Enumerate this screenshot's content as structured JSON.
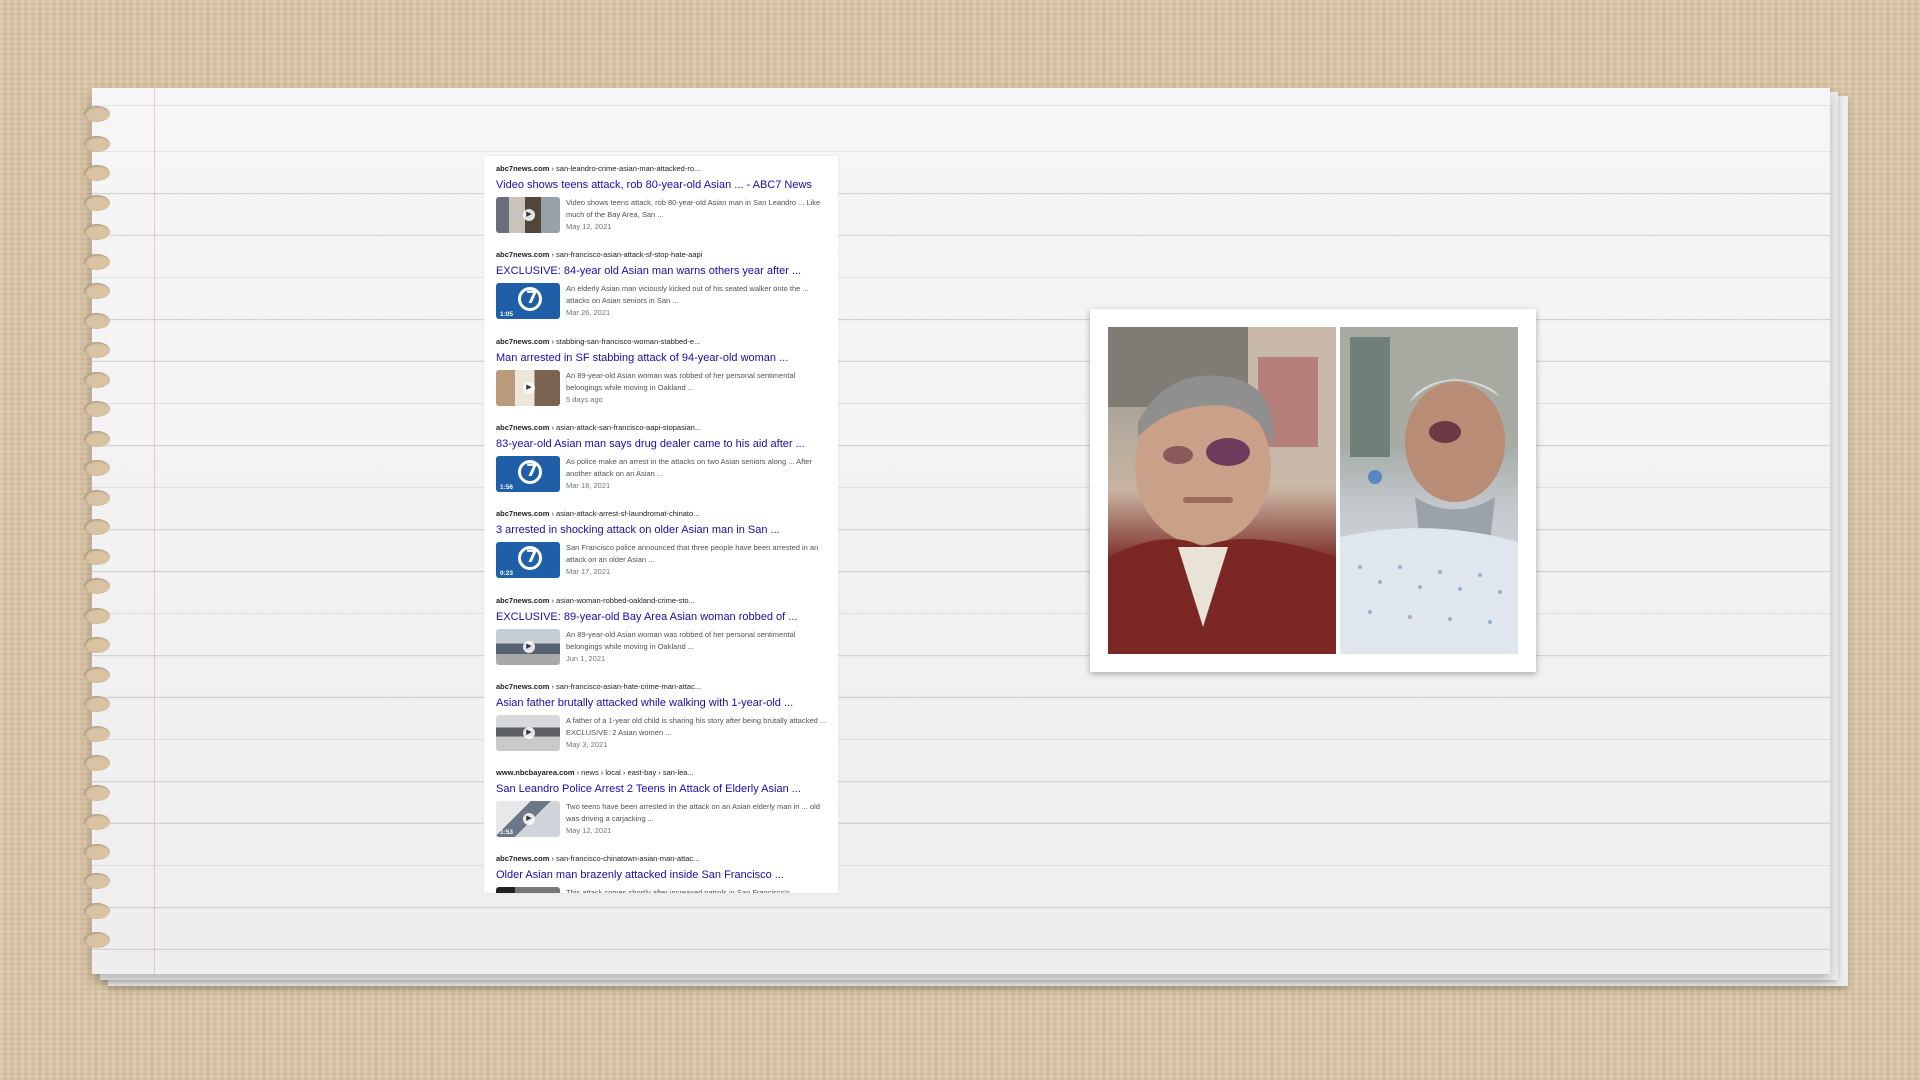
{
  "results": [
    {
      "cite_domain": "abc7news.com",
      "cite_path": " › san-leandro-crime-asian-man-attacked-ro...",
      "title": "Video shows teens attack, rob 80-year-old Asian ... - ABC7 News",
      "thumb": "photo1",
      "duration": "",
      "snippet": "Video shows teens attack, rob 80-year-old Asian man in San Leandro ... Like much of the Bay Area, San ...",
      "date": "May 12, 2021"
    },
    {
      "cite_domain": "abc7news.com",
      "cite_path": " › san-francisco-asian-attack-sf-stop-hate-aapi",
      "title": "EXCLUSIVE: 84-year old Asian man warns others year after ...",
      "thumb": "abc",
      "duration": "1:05",
      "snippet": "An elderly Asian man viciously kicked out of his seated walker onto the ... attacks on Asian seniors in San ...",
      "date": "Mar 26, 2021"
    },
    {
      "cite_domain": "abc7news.com",
      "cite_path": " › stabbing-san-francisco-woman-stabbed-e...",
      "title": "Man arrested in SF stabbing attack of 94-year-old woman ...",
      "thumb": "photo2",
      "duration": "",
      "snippet": "An 89-year-old Asian woman was robbed of her personal sentimental belongings while moving in Oakland ...",
      "date": "5 days ago"
    },
    {
      "cite_domain": "abc7news.com",
      "cite_path": " › asian-attack-san-francisco-aapi-stopasian...",
      "title": "83-year-old Asian man says drug dealer came to his aid after ...",
      "thumb": "abc",
      "duration": "1:56",
      "snippet": "As police make an arrest in the attacks on two Asian seniors along ... After another attack on an Asian ...",
      "date": "Mar 18, 2021"
    },
    {
      "cite_domain": "abc7news.com",
      "cite_path": " › asian-attack-arrest-sf-laundromat-chinato...",
      "title": "3 arrested in shocking attack on older Asian man in San ...",
      "thumb": "abc",
      "duration": "0:23",
      "snippet": "San Francisco police announced that three people have been arrested in an attack on an older Asian ...",
      "date": "Mar 17, 2021"
    },
    {
      "cite_domain": "abc7news.com",
      "cite_path": " › asian-woman-robbed-oakland-crime-sto...",
      "title": "EXCLUSIVE: 89-year-old Bay Area Asian woman robbed of ...",
      "thumb": "photo3",
      "duration": "",
      "snippet": "An 89-year-old Asian woman was robbed of her personal sentimental belongings while moving in Oakland ...",
      "date": "Jun 1, 2021"
    },
    {
      "cite_domain": "abc7news.com",
      "cite_path": " › san-francisco-asian-hate-crime-man-attac...",
      "title": "Asian father brutally attacked while walking with 1-year-old ...",
      "thumb": "photo4",
      "duration": "",
      "snippet": "A father of a 1-year old child is sharing his story after being brutally attacked ... EXCLUSIVE: 2 Asian women ...",
      "date": "May 3, 2021"
    },
    {
      "cite_domain": "www.nbcbayarea.com",
      "cite_path": " › news › local › east-bay › san-lea...",
      "title": "San Leandro Police Arrest 2 Teens in Attack of Elderly Asian ...",
      "thumb": "photo5",
      "duration": "1:53",
      "snippet": "Two teens have been arrested in the attack on an Asian elderly man in ... old was driving a carjacking ...",
      "date": "May 12, 2021"
    },
    {
      "cite_domain": "abc7news.com",
      "cite_path": " › san-francisco-chinatown-asian-man-attac...",
      "title": "Older Asian man brazenly attacked inside San Francisco ...",
      "thumb": "photo6",
      "duration": "",
      "snippet": "This attack comes shortly after increased patrols in San Francisco's ...",
      "date": ""
    }
  ]
}
